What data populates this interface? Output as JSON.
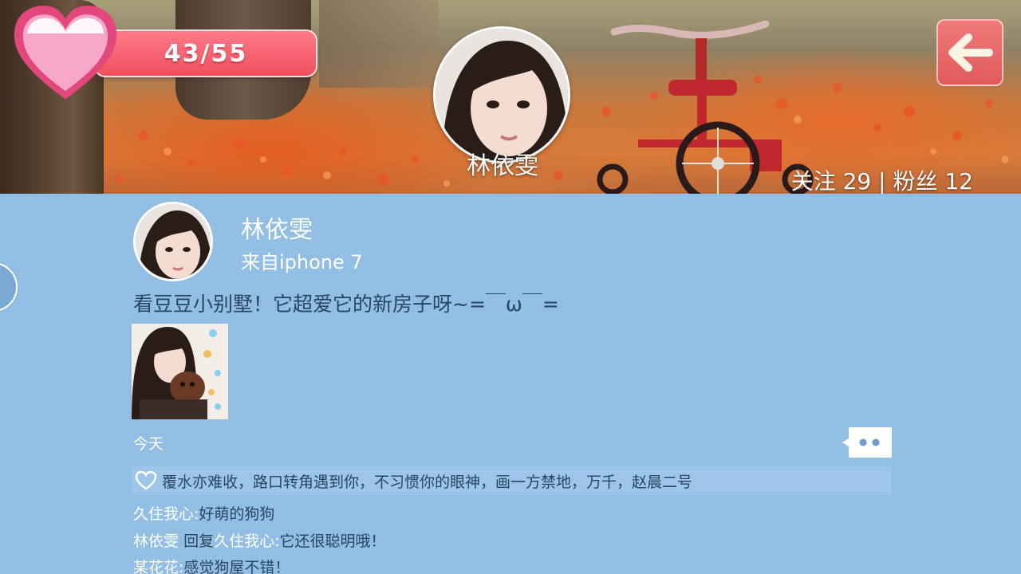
{
  "hud": {
    "progress_text": "43/55",
    "progress_current": 43,
    "progress_total": 55,
    "heart_color": "#f58fb8",
    "pill_color": "#f0505f"
  },
  "header": {
    "profile_name": "林依雯",
    "follow_stats": "关注 29 | 粉丝 12"
  },
  "post": {
    "author": "林依雯",
    "source": "来自iphone 7",
    "text": "看豆豆小别墅！它超爱它的新房子呀~=￣ω￣=",
    "time": "今天",
    "likes": "覆水亦难收，路口转角遇到你，不习惯你的眼神，画一方禁地，万千，赵晨二号"
  },
  "comments": [
    {
      "author": "久住我心",
      "sep": ":",
      "body": "好萌的狗狗"
    },
    {
      "author": "林依雯",
      "reply_word": "回复",
      "reply_to": "久住我心",
      "sep": ":",
      "body": "它还很聪明哦！"
    },
    {
      "author": "某花花",
      "sep": ":",
      "body": "感觉狗屋不错！"
    }
  ],
  "icons": {
    "back": "arrow-left-icon",
    "heart": "heart-icon",
    "like": "heart-outline-icon",
    "comment": "speech-bubble-icon"
  },
  "colors": {
    "feed_bg": "#8fbde3",
    "text_dark": "#2a4560",
    "back_button": "#e05a5a"
  }
}
